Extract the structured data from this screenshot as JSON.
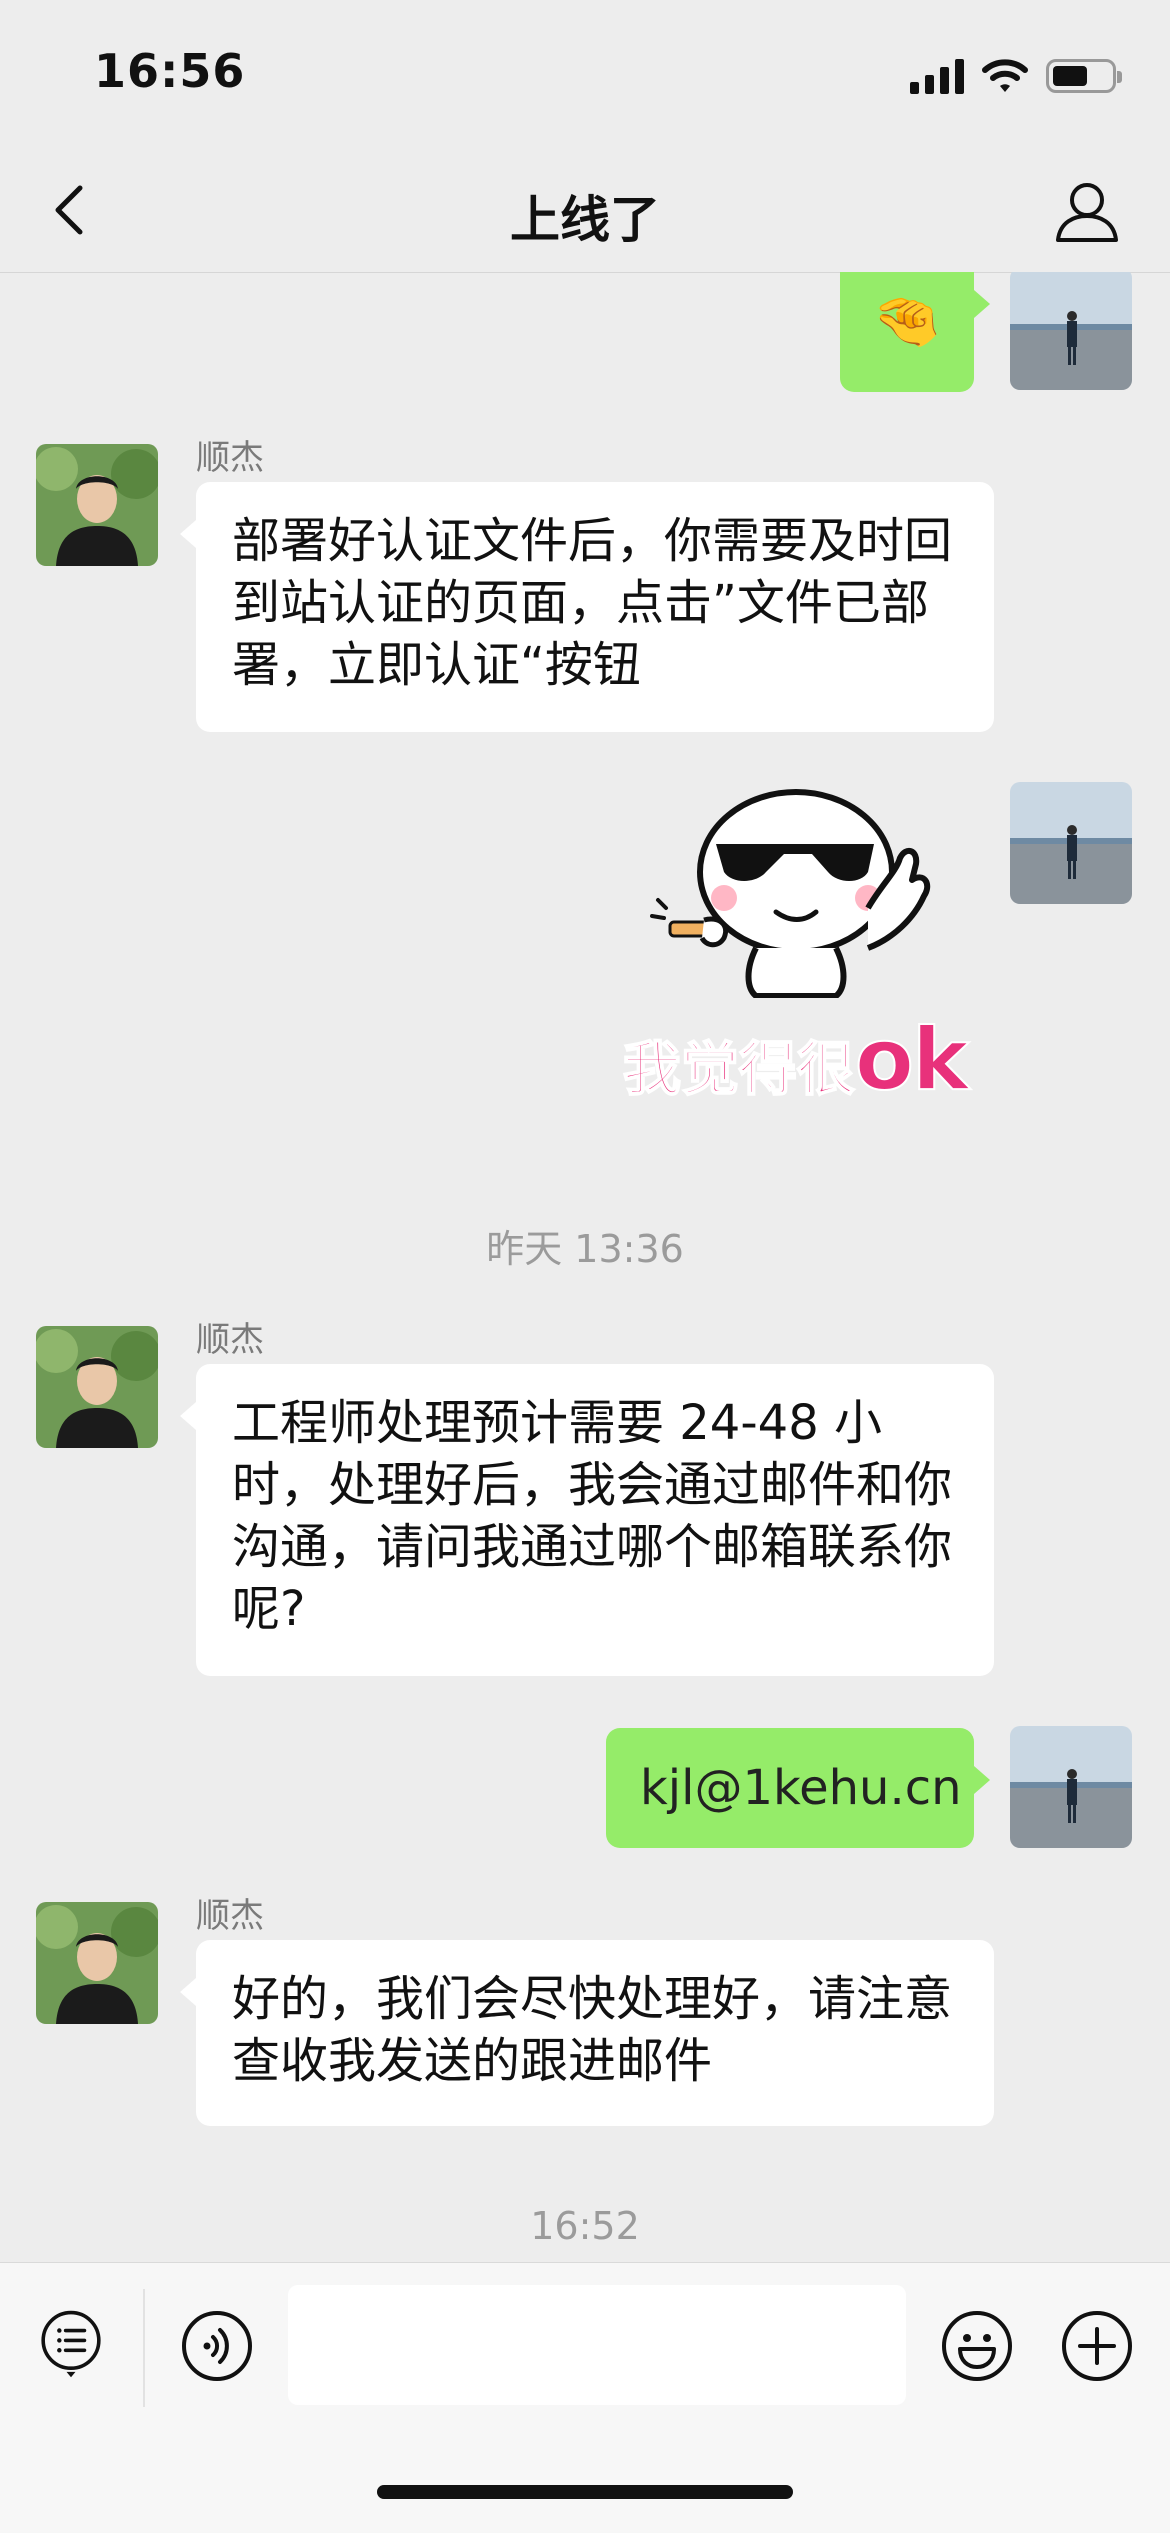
{
  "status_bar": {
    "time": "16:56"
  },
  "nav": {
    "title": "上线了"
  },
  "messages": [
    {
      "type": "emoji",
      "side": "out",
      "emoji": "🤏"
    },
    {
      "type": "text",
      "side": "in",
      "sender": "顺杰",
      "text": "部署好认证文件后，你需要及时回到站认证的页面，点击”文件已部署，立即认证“按钮"
    },
    {
      "type": "sticker",
      "side": "out",
      "caption_a": "我觉得很",
      "caption_b": "ok"
    },
    {
      "type": "timestamp",
      "text": "昨天 13:36"
    },
    {
      "type": "text",
      "side": "in",
      "sender": "顺杰",
      "text": "工程师处理预计需要 24-48 小时，处理好后，我会通过邮件和你沟通，请问我通过哪个邮箱联系你呢?"
    },
    {
      "type": "text",
      "side": "out",
      "text": "kjl@1kehu.cn"
    },
    {
      "type": "text",
      "side": "in",
      "sender": "顺杰",
      "text": "好的，我们会尽快处理好，请注意查收我发送的跟进邮件"
    },
    {
      "type": "timestamp",
      "text": "16:52"
    }
  ],
  "colors": {
    "background": "#ededed",
    "outgoing_bubble": "#95ec69",
    "incoming_bubble": "#ffffff",
    "sticker_pink": "#e8317b"
  },
  "input_bar": {
    "icons": [
      "menu-list-icon",
      "voice-icon",
      "emoji-icon",
      "plus-icon"
    ]
  }
}
